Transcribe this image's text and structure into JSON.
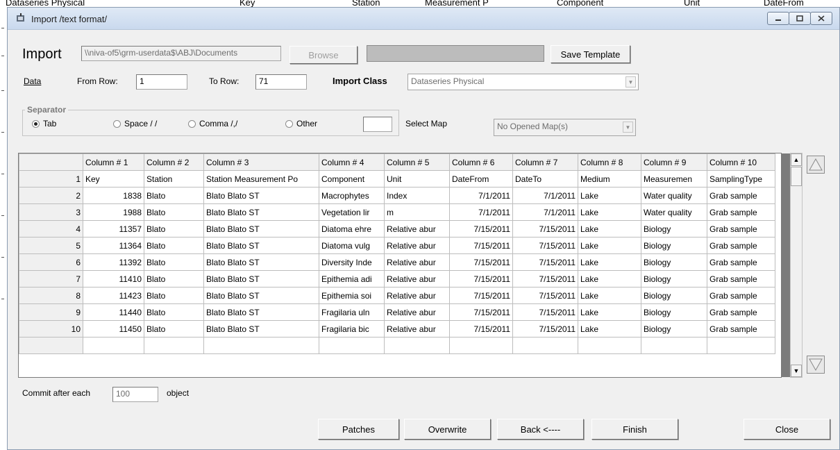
{
  "background_strip": [
    "Dataseries Physical",
    "Key",
    "Station",
    "Measurement P",
    "Component",
    "Unit",
    "DateFrom"
  ],
  "window": {
    "title": "Import /text format/"
  },
  "import": {
    "heading": "Import",
    "path": "\\\\niva-of5\\grm-userdata$\\ABJ\\Documents",
    "browse_label": "Browse",
    "save_template_label": "Save Template"
  },
  "data_row": {
    "data_link": "Data",
    "from_row_label": "From Row:",
    "from_row_value": "1",
    "to_row_label": "To Row:",
    "to_row_value": "71",
    "import_class_label": "Import Class",
    "import_class_value": "Dataseries Physical"
  },
  "separator": {
    "title": "Separator",
    "options": [
      "Tab",
      "Space / /",
      "Comma /,/",
      "Other"
    ],
    "selected": "Tab",
    "other_value": "",
    "select_map_label": "Select Map",
    "map_value": "No Opened Map(s)"
  },
  "grid": {
    "headers": [
      "",
      "Column # 1",
      "Column # 2",
      "Column # 3",
      "Column # 4",
      "Column # 5",
      "Column # 6",
      "Column # 7",
      "Column # 8",
      "Column # 9",
      "Column # 10"
    ],
    "rows": [
      [
        "1",
        "Key",
        "Station",
        "Station Measurement Po",
        "Component",
        "Unit",
        "DateFrom",
        "DateTo",
        "Medium",
        "Measuremen",
        "SamplingType"
      ],
      [
        "2",
        "1838",
        "Blato",
        "Blato Blato ST",
        "Macrophytes",
        "Index",
        "7/1/2011",
        "7/1/2011",
        "Lake",
        "Water quality",
        "Grab sample"
      ],
      [
        "3",
        "1988",
        "Blato",
        "Blato Blato ST",
        "Vegetation lir",
        "m",
        "7/1/2011",
        "7/1/2011",
        "Lake",
        "Water quality",
        "Grab sample"
      ],
      [
        "4",
        "11357",
        "Blato",
        "Blato Blato ST",
        "Diatoma ehre",
        "Relative abur",
        "7/15/2011",
        "7/15/2011",
        "Lake",
        "Biology",
        "Grab sample"
      ],
      [
        "5",
        "11364",
        "Blato",
        "Blato Blato ST",
        "Diatoma vulg",
        "Relative abur",
        "7/15/2011",
        "7/15/2011",
        "Lake",
        "Biology",
        "Grab sample"
      ],
      [
        "6",
        "11392",
        "Blato",
        "Blato Blato ST",
        "Diversity Inde",
        "Relative abur",
        "7/15/2011",
        "7/15/2011",
        "Lake",
        "Biology",
        "Grab sample"
      ],
      [
        "7",
        "11410",
        "Blato",
        "Blato Blato ST",
        "Epithemia adi",
        "Relative abur",
        "7/15/2011",
        "7/15/2011",
        "Lake",
        "Biology",
        "Grab sample"
      ],
      [
        "8",
        "11423",
        "Blato",
        "Blato Blato ST",
        "Epithemia soi",
        "Relative abur",
        "7/15/2011",
        "7/15/2011",
        "Lake",
        "Biology",
        "Grab sample"
      ],
      [
        "9",
        "11440",
        "Blato",
        "Blato Blato ST",
        "Fragilaria uln",
        "Relative abur",
        "7/15/2011",
        "7/15/2011",
        "Lake",
        "Biology",
        "Grab sample"
      ],
      [
        "10",
        "11450",
        "Blato",
        "Blato Blato ST",
        "Fragilaria bic",
        "Relative abur",
        "7/15/2011",
        "7/15/2011",
        "Lake",
        "Biology",
        "Grab sample"
      ],
      [
        "",
        "",
        "",
        "",
        "",
        "",
        "",
        "",
        "",
        "",
        ""
      ]
    ]
  },
  "commit": {
    "prefix": "Commit after each",
    "value": "100",
    "suffix": "object"
  },
  "buttons": {
    "patches": "Patches",
    "overwrite": "Overwrite",
    "back": "Back <----",
    "finish": "Finish",
    "close": "Close"
  }
}
